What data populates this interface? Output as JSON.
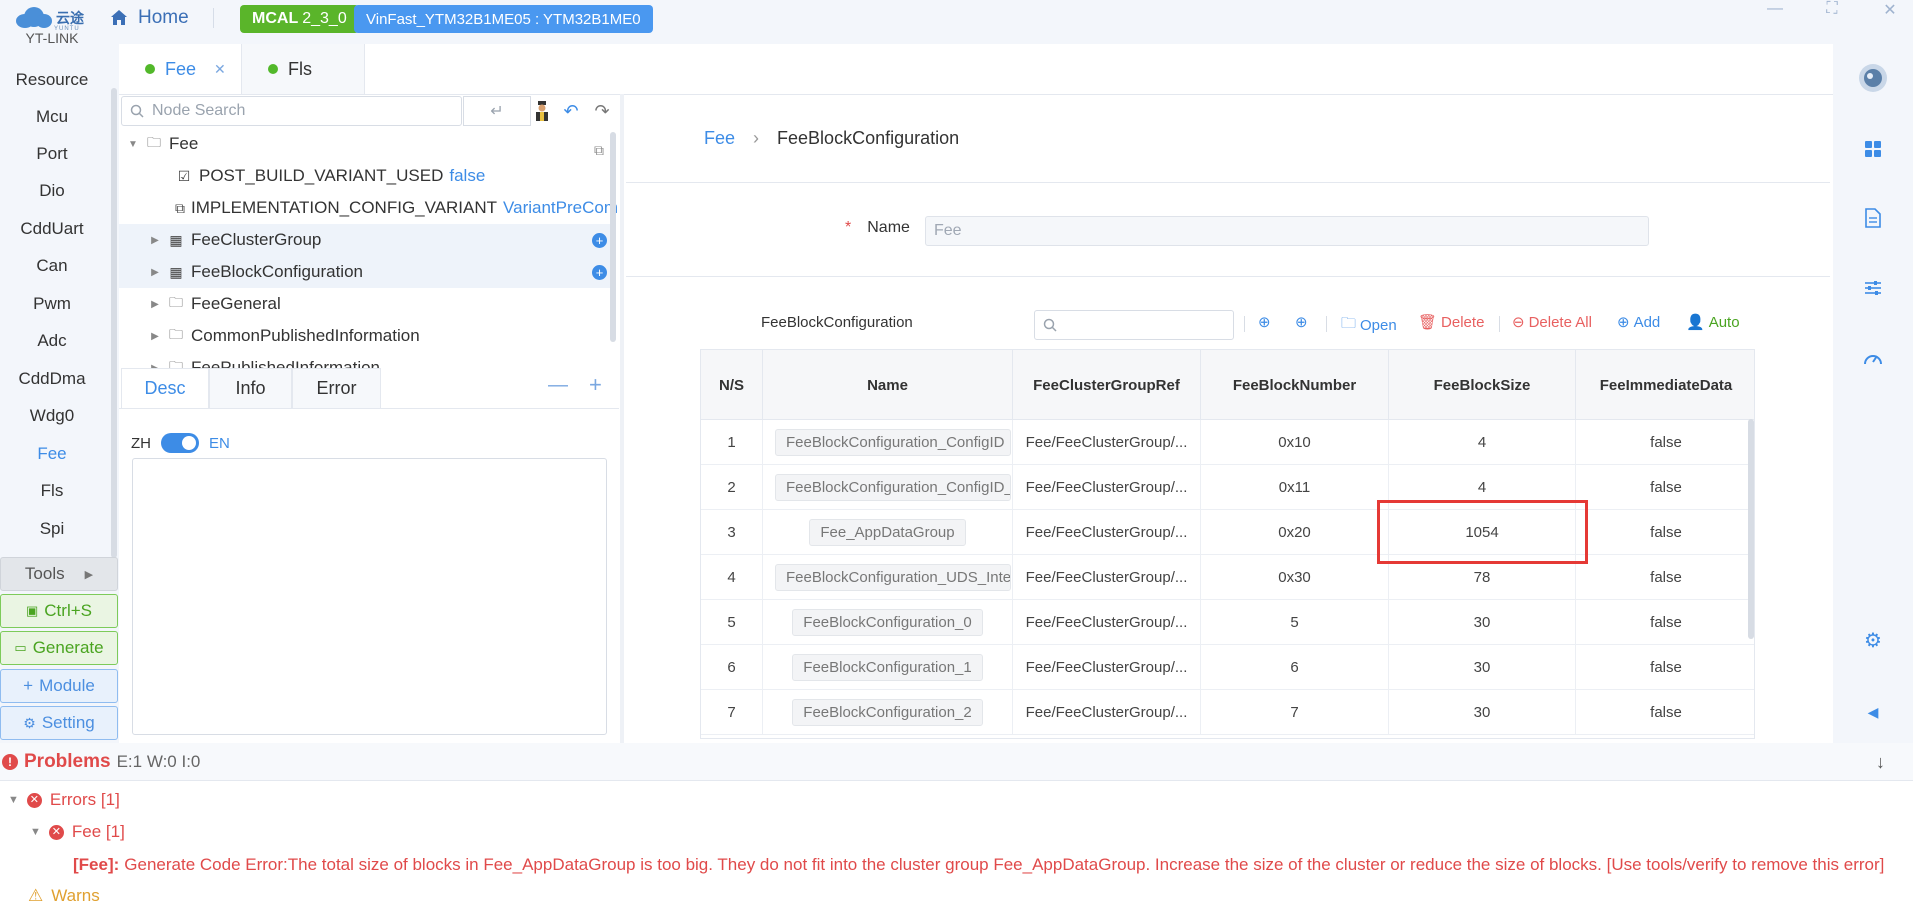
{
  "topbar": {
    "logo_text": "云途",
    "logo_sub": "YUNTU",
    "home_label": "Home",
    "mcal_label": "MCAL",
    "mcal_version": "2_3_0",
    "project_label": "VinFast_YTM32B1ME05 : YTM32B1ME0"
  },
  "leftnav": {
    "top_cut": "YT-LINK",
    "items": [
      "Resource",
      "Mcu",
      "Port",
      "Dio",
      "CddUart",
      "Can",
      "Pwm",
      "Adc",
      "CddDma",
      "Wdg0",
      "Fee",
      "Fls",
      "Spi"
    ],
    "active": "Fee",
    "tools_label": "Tools",
    "save_label": "Ctrl+S",
    "generate_label": "Generate",
    "module_label": "Module",
    "setting_label": "Setting"
  },
  "tabs": [
    {
      "label": "Fee",
      "active": true,
      "closable": true
    },
    {
      "label": "Fls",
      "active": false,
      "closable": false
    }
  ],
  "tree": {
    "search_placeholder": "Node Search",
    "root": "Fee",
    "rows": [
      {
        "label": "POST_BUILD_VARIANT_USED",
        "value": "false",
        "icon": "checkbox-icon"
      },
      {
        "label": "IMPLEMENTATION_CONFIG_VARIANT",
        "value": "VariantPreCompi",
        "icon": "select-icon"
      },
      {
        "label": "FeeClusterGroup",
        "icon": "table-icon"
      },
      {
        "label": "FeeBlockConfiguration",
        "icon": "table-icon"
      },
      {
        "label": "FeeGeneral",
        "icon": "folder-icon"
      },
      {
        "label": "CommonPublishedInformation",
        "icon": "folder-icon"
      },
      {
        "label": "FeePublishedInformation",
        "icon": "folder-icon"
      }
    ]
  },
  "desc_panel": {
    "tabs": [
      "Desc",
      "Info",
      "Error"
    ],
    "active_tab": "Desc",
    "lang_left": "ZH",
    "lang_right": "EN"
  },
  "content": {
    "breadcrumb_root": "Fee",
    "breadcrumb_current": "FeeBlockConfiguration",
    "name_label": "Name",
    "name_value": "Fee",
    "table_title": "FeeBlockConfiguration",
    "actions": {
      "open": "Open",
      "delete": "Delete",
      "delete_all": "Delete All",
      "add": "Add",
      "auto": "Auto"
    },
    "columns": [
      "N/S",
      "Name",
      "FeeClusterGroupRef",
      "FeeBlockNumber",
      "FeeBlockSize",
      "FeeImmediateData"
    ],
    "rows": [
      {
        "ns": "1",
        "name": "FeeBlockConfiguration_ConfigID",
        "ref": "Fee/FeeClusterGroup/...",
        "num": "0x10",
        "size": "4",
        "imm": "false"
      },
      {
        "ns": "2",
        "name": "FeeBlockConfiguration_ConfigID_B",
        "ref": "Fee/FeeClusterGroup/...",
        "num": "0x11",
        "size": "4",
        "imm": "false"
      },
      {
        "ns": "3",
        "name": "Fee_AppDataGroup",
        "ref": "Fee/FeeClusterGroup/...",
        "num": "0x20",
        "size": "1054",
        "imm": "false"
      },
      {
        "ns": "4",
        "name": "FeeBlockConfiguration_UDS_Internal",
        "ref": "Fee/FeeClusterGroup/...",
        "num": "0x30",
        "size": "78",
        "imm": "false"
      },
      {
        "ns": "5",
        "name": "FeeBlockConfiguration_0",
        "ref": "Fee/FeeClusterGroup/...",
        "num": "5",
        "size": "30",
        "imm": "false"
      },
      {
        "ns": "6",
        "name": "FeeBlockConfiguration_1",
        "ref": "Fee/FeeClusterGroup/...",
        "num": "6",
        "size": "30",
        "imm": "false"
      },
      {
        "ns": "7",
        "name": "FeeBlockConfiguration_2",
        "ref": "Fee/FeeClusterGroup/...",
        "num": "7",
        "size": "30",
        "imm": "false"
      }
    ]
  },
  "problems": {
    "title": "Problems",
    "counts": "E:1 W:0 I:0",
    "errors_label": "Errors [1]",
    "fee_label": "Fee [1]",
    "error_prefix": "[Fee]:",
    "error_message": "Generate Code Error:The total size of blocks in Fee_AppDataGroup is too big. They do not fit into the cluster group Fee_AppDataGroup. Increase the size of the cluster or reduce the size of blocks. [Use tools/verify to remove this error]",
    "warns_label": "Warns"
  },
  "colors": {
    "accent": "#3d8ce6",
    "success": "#5ab52a",
    "error": "#e04a4a",
    "highlight_box": "#e53935"
  }
}
